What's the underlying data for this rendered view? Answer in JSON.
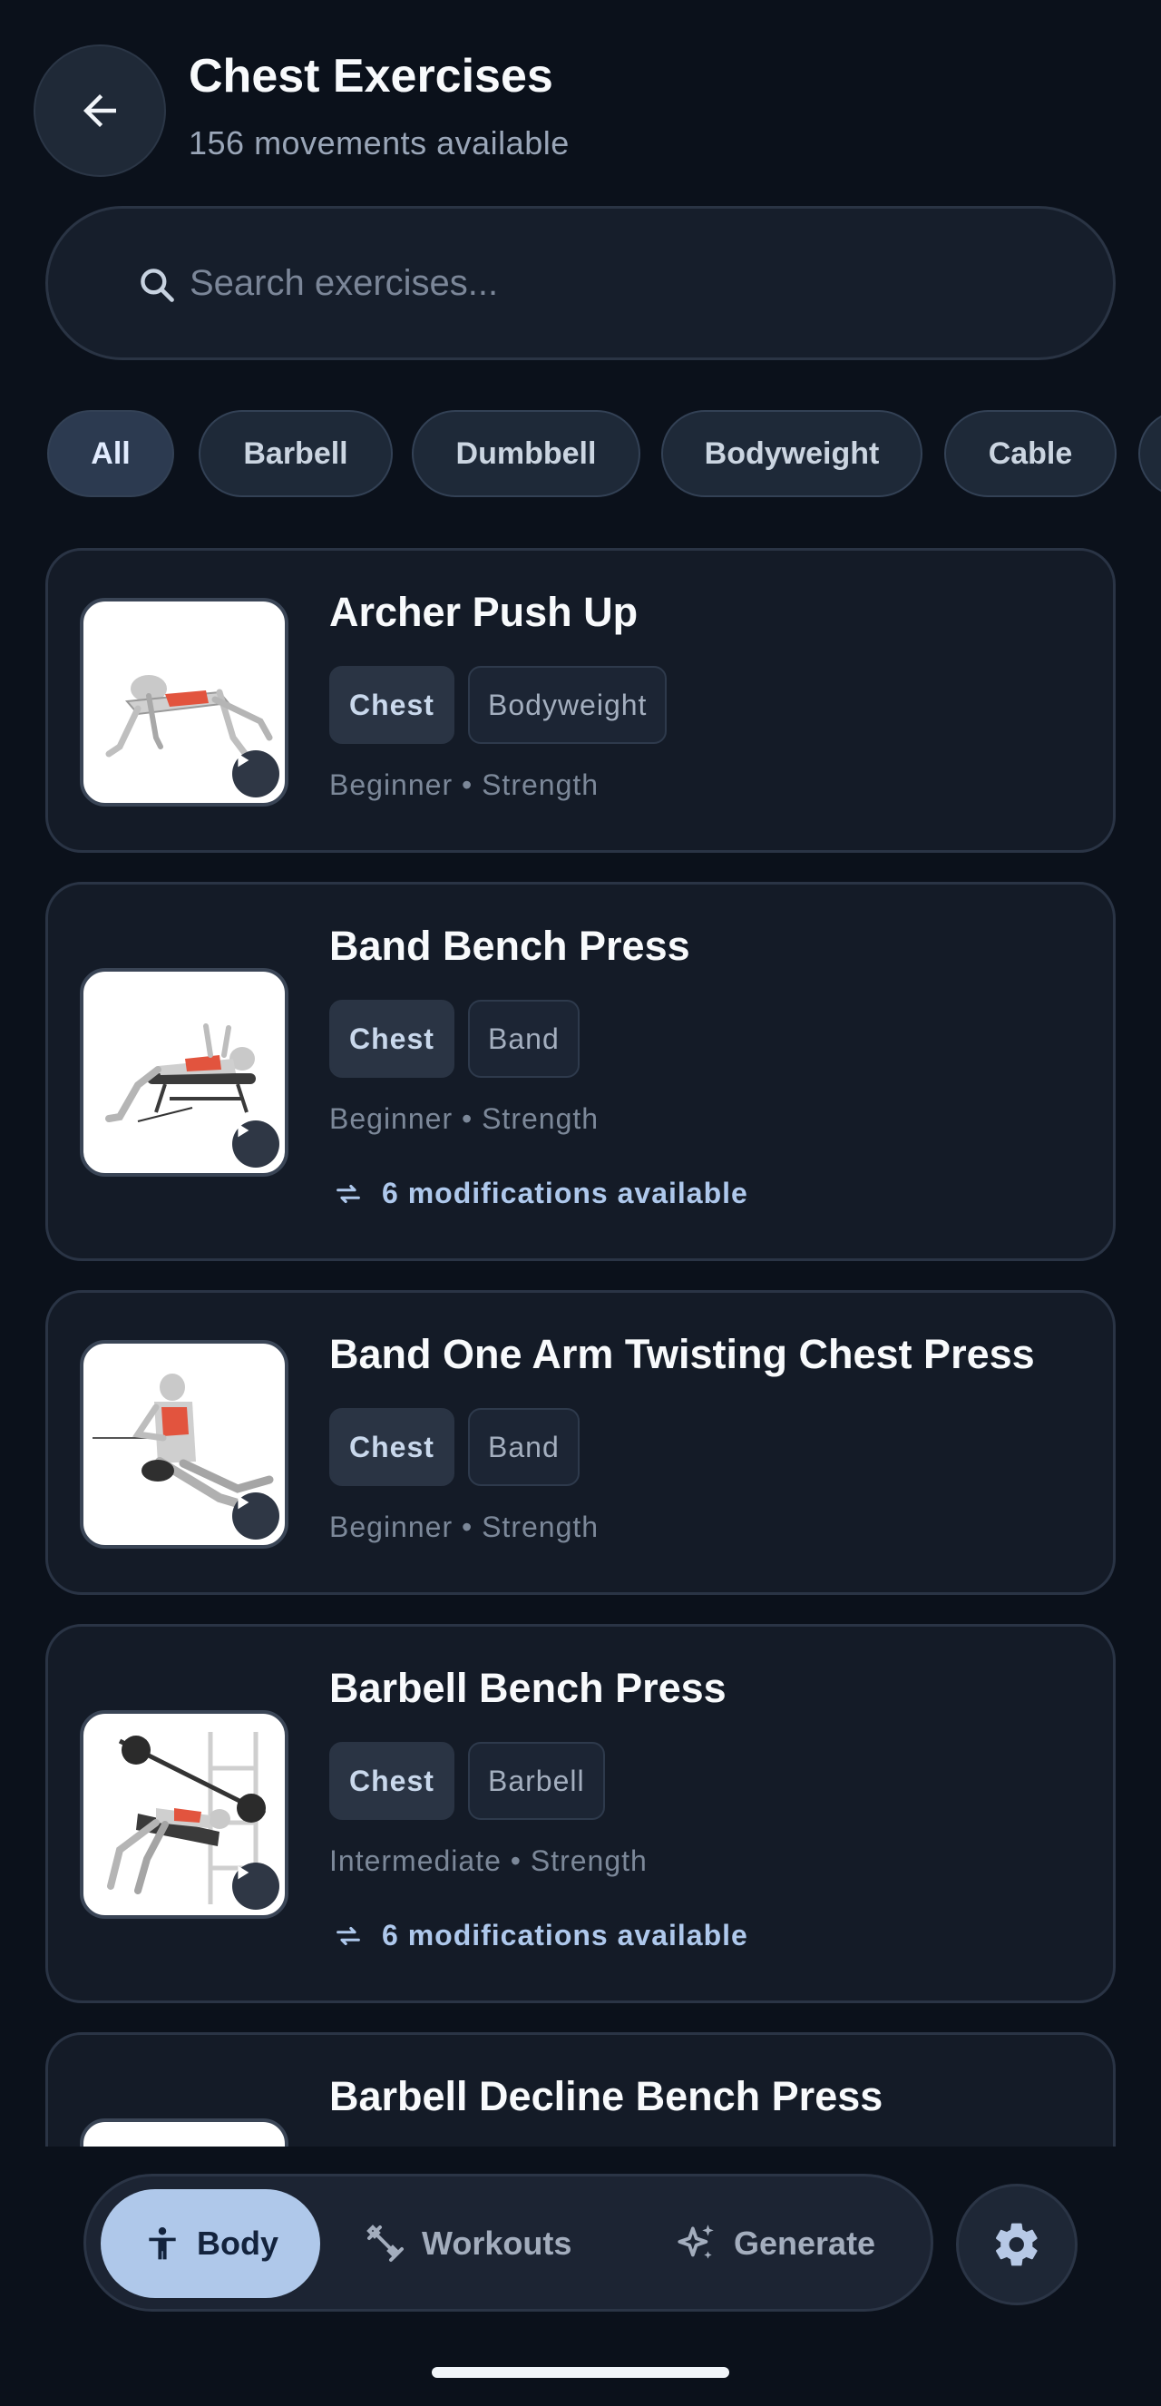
{
  "header": {
    "title": "Chest Exercises",
    "subtitle": "156 movements available"
  },
  "search": {
    "placeholder": "Search exercises..."
  },
  "filters": [
    "All",
    "Barbell",
    "Dumbbell",
    "Bodyweight",
    "Cable"
  ],
  "exercises": [
    {
      "name": "Archer Push Up",
      "muscle": "Chest",
      "equipment": "Bodyweight",
      "meta": "Beginner • Strength",
      "mods": ""
    },
    {
      "name": "Band Bench Press",
      "muscle": "Chest",
      "equipment": "Band",
      "meta": "Beginner • Strength",
      "mods": "6 modifications available"
    },
    {
      "name": "Band One Arm Twisting Chest Press",
      "muscle": "Chest",
      "equipment": "Band",
      "meta": "Beginner • Strength",
      "mods": ""
    },
    {
      "name": "Barbell Bench Press",
      "muscle": "Chest",
      "equipment": "Barbell",
      "meta": "Intermediate • Strength",
      "mods": "6 modifications available"
    },
    {
      "name": "Barbell Decline Bench Press",
      "muscle": "",
      "equipment": "",
      "meta": "",
      "mods": ""
    }
  ],
  "nav": {
    "body": "Body",
    "workouts": "Workouts",
    "generate": "Generate"
  },
  "colors": {
    "background": "#0b111b",
    "card": "#141b27",
    "accent": "#afc8ea",
    "muscle_highlight": "#e2543e"
  }
}
